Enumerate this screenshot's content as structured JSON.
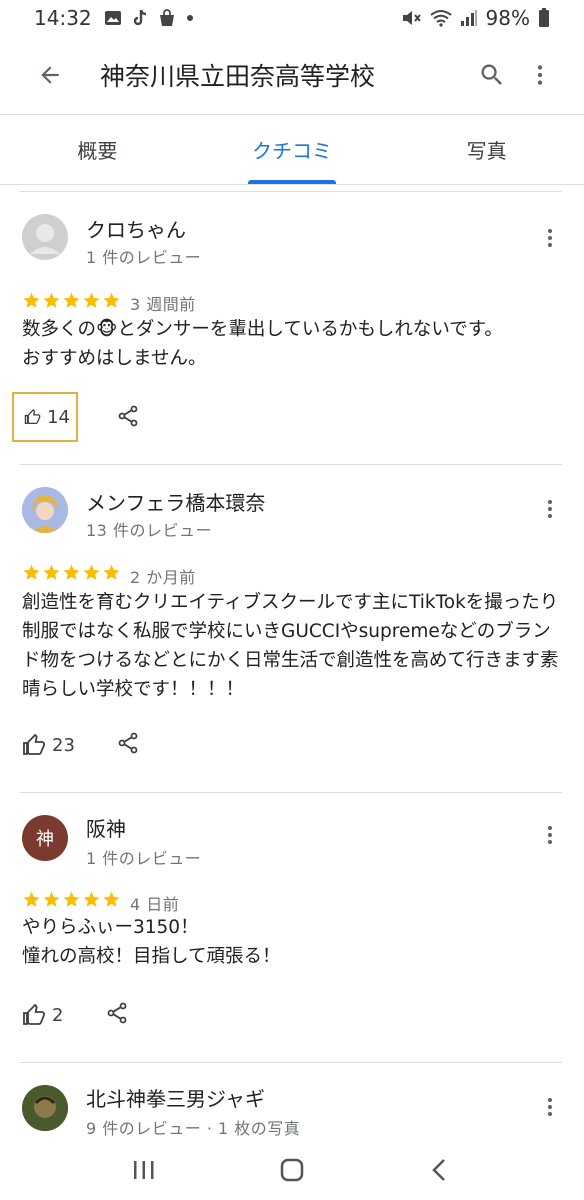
{
  "status_bar": {
    "time": "14:32",
    "battery": "98%",
    "icons": [
      "gallery-icon",
      "tiktok-icon",
      "shopping-bag-icon",
      "dot-icon",
      "mute-icon",
      "wifi-icon",
      "signal-icon",
      "battery-icon"
    ]
  },
  "app_bar": {
    "title": "神奈川県立田奈高等学校",
    "back_icon": "back-arrow-icon",
    "search_icon": "search-icon",
    "more_icon": "more-vert-icon"
  },
  "tabs": [
    {
      "label": "概要",
      "active": false
    },
    {
      "label": "クチコミ",
      "active": true
    },
    {
      "label": "写真",
      "active": false
    }
  ],
  "colors": {
    "accent": "#1a73e8",
    "star": "#fbbc04",
    "focus_ring": "#e2b13c",
    "secondary_text": "#70757a"
  },
  "reviews": [
    {
      "name": "クロちゃん",
      "review_count": "1 件のレビュー",
      "rating": 5,
      "date": "3 週間前",
      "text": "数多くの🐵とダンサーを輩出しているかもしれないです。\nおすすめはしません。",
      "likes": "14"
    },
    {
      "name": "メンフェラ橋本環奈",
      "review_count": "13 件のレビュー",
      "rating": 5,
      "date": "2 か月前",
      "text": "創造性を育むクリエイティブスクールです主にTikTokを撮ったり制服ではなく私服で学校にいきGUCCIやsupremeなどのブランド物をつけるなどとにかく日常生活で創造性を高めて行きます素晴らしい学校です！！！！",
      "likes": "23"
    },
    {
      "name": "阪神",
      "avatar_letter": "神",
      "review_count": "1 件のレビュー",
      "rating": 5,
      "date": "4 日前",
      "text": "やりらふぃー3150！\n憧れの高校！目指して頑張る！",
      "likes": "2"
    },
    {
      "name": "北斗神拳三男ジャギ",
      "review_count": "9 件のレビュー · 1 枚の写真"
    }
  ],
  "nav_bar": {
    "recents_icon": "recents-icon",
    "home_icon": "home-icon",
    "back_icon": "nav-back-icon"
  }
}
